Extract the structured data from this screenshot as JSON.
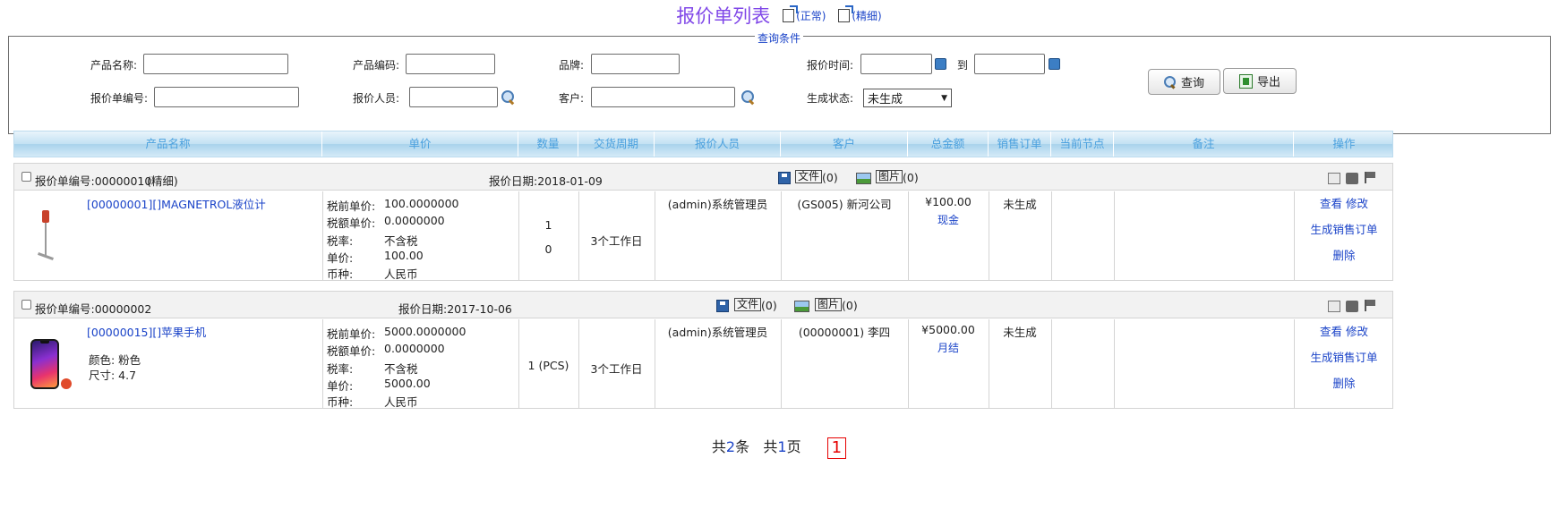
{
  "title": {
    "main": "报价单列表",
    "link_normal": "(正常)",
    "link_detail": "(精细)"
  },
  "query": {
    "legend": "查询条件",
    "product_name_label": "产品名称:",
    "product_code_label": "产品编码:",
    "brand_label": "品牌:",
    "quote_time_label": "报价时间:",
    "to_label": "到",
    "quote_no_label": "报价单编号:",
    "quoter_label": "报价人员:",
    "customer_label": "客户:",
    "gen_status_label": "生成状态:",
    "gen_status_value": "未生成",
    "search_btn": "查询",
    "export_btn": "导出"
  },
  "table": {
    "headers": [
      "产品名称",
      "单价",
      "数量",
      "交货周期",
      "报价人员",
      "客户",
      "总金额",
      "销售订单",
      "当前节点",
      "备注",
      "操作"
    ]
  },
  "quotes": [
    {
      "no_label": "报价单编号:00000010",
      "tag": "(精细)",
      "date_label": "报价日期:2018-01-09",
      "file_label": "文件",
      "file_count": "(0)",
      "image_label": "图片",
      "image_count": "(0)",
      "product": "[00000001][]MAGNETROL液位计",
      "attrs": [],
      "price_keys": [
        "税前单价:",
        "税额单价:",
        "税率:",
        "单价:",
        "币种:"
      ],
      "price_vals": [
        "100.0000000",
        "0.0000000",
        "不含税",
        "100.00",
        "人民币"
      ],
      "qty_1": "1",
      "qty_2": "0",
      "delivery": "3个工作日",
      "quoter": "(admin)系统管理员",
      "customer": "(GS005) 新河公司",
      "total": "¥100.00",
      "payment": "现金",
      "sales_order": "未生成",
      "op_view": "查看",
      "op_edit": "修改",
      "op_gen": "生成销售订单",
      "op_delete": "删除"
    },
    {
      "no_label": "报价单编号:00000002",
      "tag": "",
      "date_label": "报价日期:2017-10-06",
      "file_label": "文件",
      "file_count": "(0)",
      "image_label": "图片",
      "image_count": "(0)",
      "product": "[00000015][]苹果手机",
      "attrs": [
        "颜色: 粉色",
        "尺寸: 4.7"
      ],
      "price_keys": [
        "税前单价:",
        "税额单价:",
        "税率:",
        "单价:",
        "币种:"
      ],
      "price_vals": [
        "5000.0000000",
        "0.0000000",
        "不含税",
        "5000.00",
        "人民币"
      ],
      "qty_1": "1 (PCS)",
      "qty_2": "",
      "delivery": "3个工作日",
      "quoter": "(admin)系统管理员",
      "customer": "(00000001) 李四",
      "total": "¥5000.00",
      "payment": "月结",
      "sales_order": "未生成",
      "op_view": "查看",
      "op_edit": "修改",
      "op_gen": "生成销售订单",
      "op_delete": "删除"
    }
  ],
  "pager": {
    "total_prefix": "共",
    "total_count": "2",
    "total_suffix": "条",
    "pages_prefix": "共",
    "pages_count": "1",
    "pages_suffix": "页",
    "current_page": "1"
  },
  "colors": {
    "title": "#8048e8",
    "link": "#1a43c8",
    "header_text": "#4aa0de",
    "tag_red": "#e60000"
  }
}
